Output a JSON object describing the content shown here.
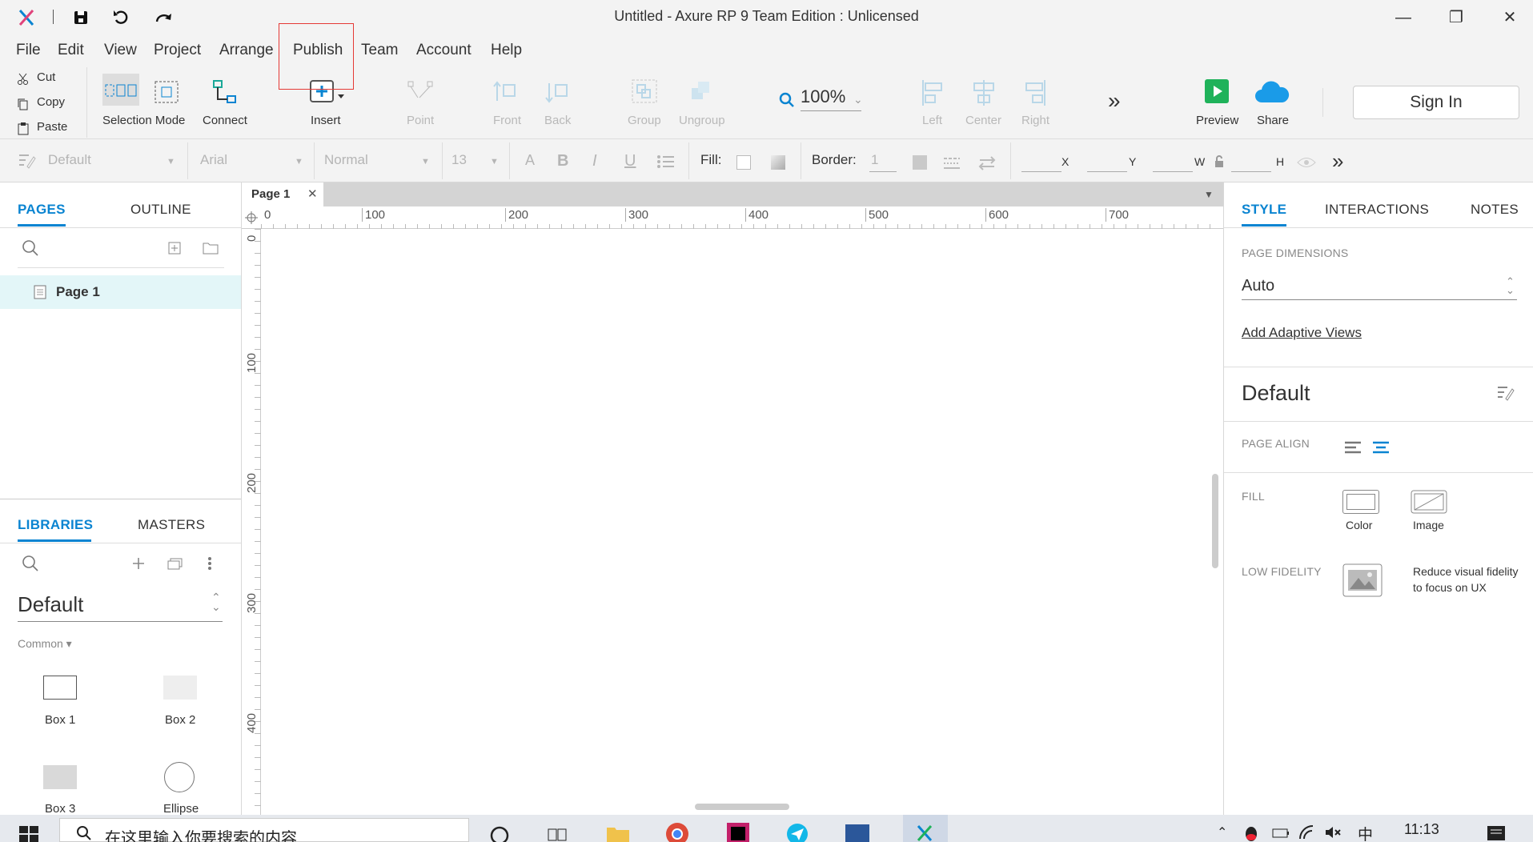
{
  "window": {
    "title": "Untitled - Axure RP 9 Team Edition : Unlicensed",
    "minimize": "—",
    "maximize": "❐",
    "close": "✕"
  },
  "menu": [
    "File",
    "Edit",
    "View",
    "Project",
    "Arrange",
    "Publish",
    "Team",
    "Account",
    "Help"
  ],
  "clipboard": {
    "cut": "Cut",
    "copy": "Copy",
    "paste": "Paste"
  },
  "toolbar": {
    "selection_mode": "Selection Mode",
    "connect": "Connect",
    "insert": "Insert",
    "point": "Point",
    "front": "Front",
    "back": "Back",
    "group": "Group",
    "ungroup": "Ungroup",
    "zoom": "100%",
    "left": "Left",
    "center": "Center",
    "right": "Right",
    "more": "»",
    "preview": "Preview",
    "share": "Share",
    "sign_in": "Sign In"
  },
  "format": {
    "style": "Default",
    "font": "Arial",
    "weight": "Normal",
    "size": "13",
    "fill_label": "Fill:",
    "border_label": "Border:",
    "border_value": "1",
    "x": "X",
    "y": "Y",
    "w": "W",
    "h": "H",
    "more": "»"
  },
  "left_panel": {
    "tabs": [
      "PAGES",
      "OUTLINE"
    ],
    "pages": [
      {
        "label": "Page 1"
      }
    ],
    "lib_tabs": [
      "LIBRARIES",
      "MASTERS"
    ],
    "library": "Default",
    "category": "Common ▾",
    "widgets": [
      "Box 1",
      "Box 2",
      "Box 3",
      "Ellipse"
    ]
  },
  "canvas": {
    "tab": "Page 1",
    "ruler_h": [
      "0",
      "100",
      "200",
      "300",
      "400",
      "500",
      "600",
      "700"
    ],
    "ruler_v": [
      "0",
      "100",
      "200",
      "300",
      "400"
    ]
  },
  "right_panel": {
    "tabs": [
      "STYLE",
      "INTERACTIONS",
      "NOTES"
    ],
    "page_dimensions_label": "PAGE DIMENSIONS",
    "page_dimensions_value": "Auto",
    "adaptive_link": "Add Adaptive Views",
    "style_name": "Default",
    "page_align_label": "PAGE ALIGN",
    "fill_label": "FILL",
    "fill_color": "Color",
    "fill_image": "Image",
    "low_fidelity_label": "LOW FIDELITY",
    "low_fidelity_desc_1": "Reduce visual fidelity",
    "low_fidelity_desc_2": "to focus on UX"
  },
  "taskbar": {
    "search_placeholder": "在这里输入你要搜索的内容",
    "time": "11:13",
    "ime": "中"
  },
  "colors": {
    "accent": "#0a84d1",
    "preview_green": "#1fb25a",
    "share_blue": "#1a9be8",
    "highlight_red": "#e53935"
  }
}
